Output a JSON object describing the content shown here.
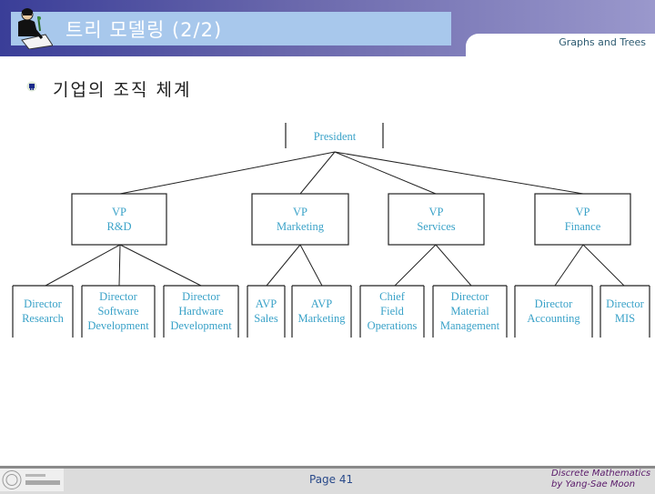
{
  "header": {
    "title": "트리 모델링 (2/2)",
    "subtitle": "Graphs and Trees"
  },
  "content": {
    "heading": "기업의 조직 체계"
  },
  "org_chart": {
    "root": {
      "lines": [
        "President"
      ]
    },
    "level1": [
      {
        "lines": [
          "VP",
          "R&D"
        ]
      },
      {
        "lines": [
          "VP",
          "Marketing"
        ]
      },
      {
        "lines": [
          "VP",
          "Services"
        ]
      },
      {
        "lines": [
          "VP",
          "Finance"
        ]
      }
    ],
    "level2": [
      {
        "parent": 0,
        "lines": [
          "Director",
          "Research"
        ]
      },
      {
        "parent": 0,
        "lines": [
          "Director",
          "Software",
          "Development"
        ]
      },
      {
        "parent": 0,
        "lines": [
          "Director",
          "Hardware",
          "Development"
        ]
      },
      {
        "parent": 1,
        "lines": [
          "AVP",
          "Sales"
        ]
      },
      {
        "parent": 1,
        "lines": [
          "AVP",
          "Marketing"
        ]
      },
      {
        "parent": 2,
        "lines": [
          "Chief",
          "Field",
          "Operations"
        ]
      },
      {
        "parent": 2,
        "lines": [
          "Director",
          "Material",
          "Management"
        ]
      },
      {
        "parent": 3,
        "lines": [
          "Director",
          "Accounting"
        ]
      },
      {
        "parent": 3,
        "lines": [
          "Director",
          "MIS"
        ]
      }
    ],
    "label_color": "#3aa2c8"
  },
  "footer": {
    "page": "Page 41",
    "credit_line1": "Discrete Mathematics",
    "credit_line2": "by Yang-Sae Moon"
  }
}
